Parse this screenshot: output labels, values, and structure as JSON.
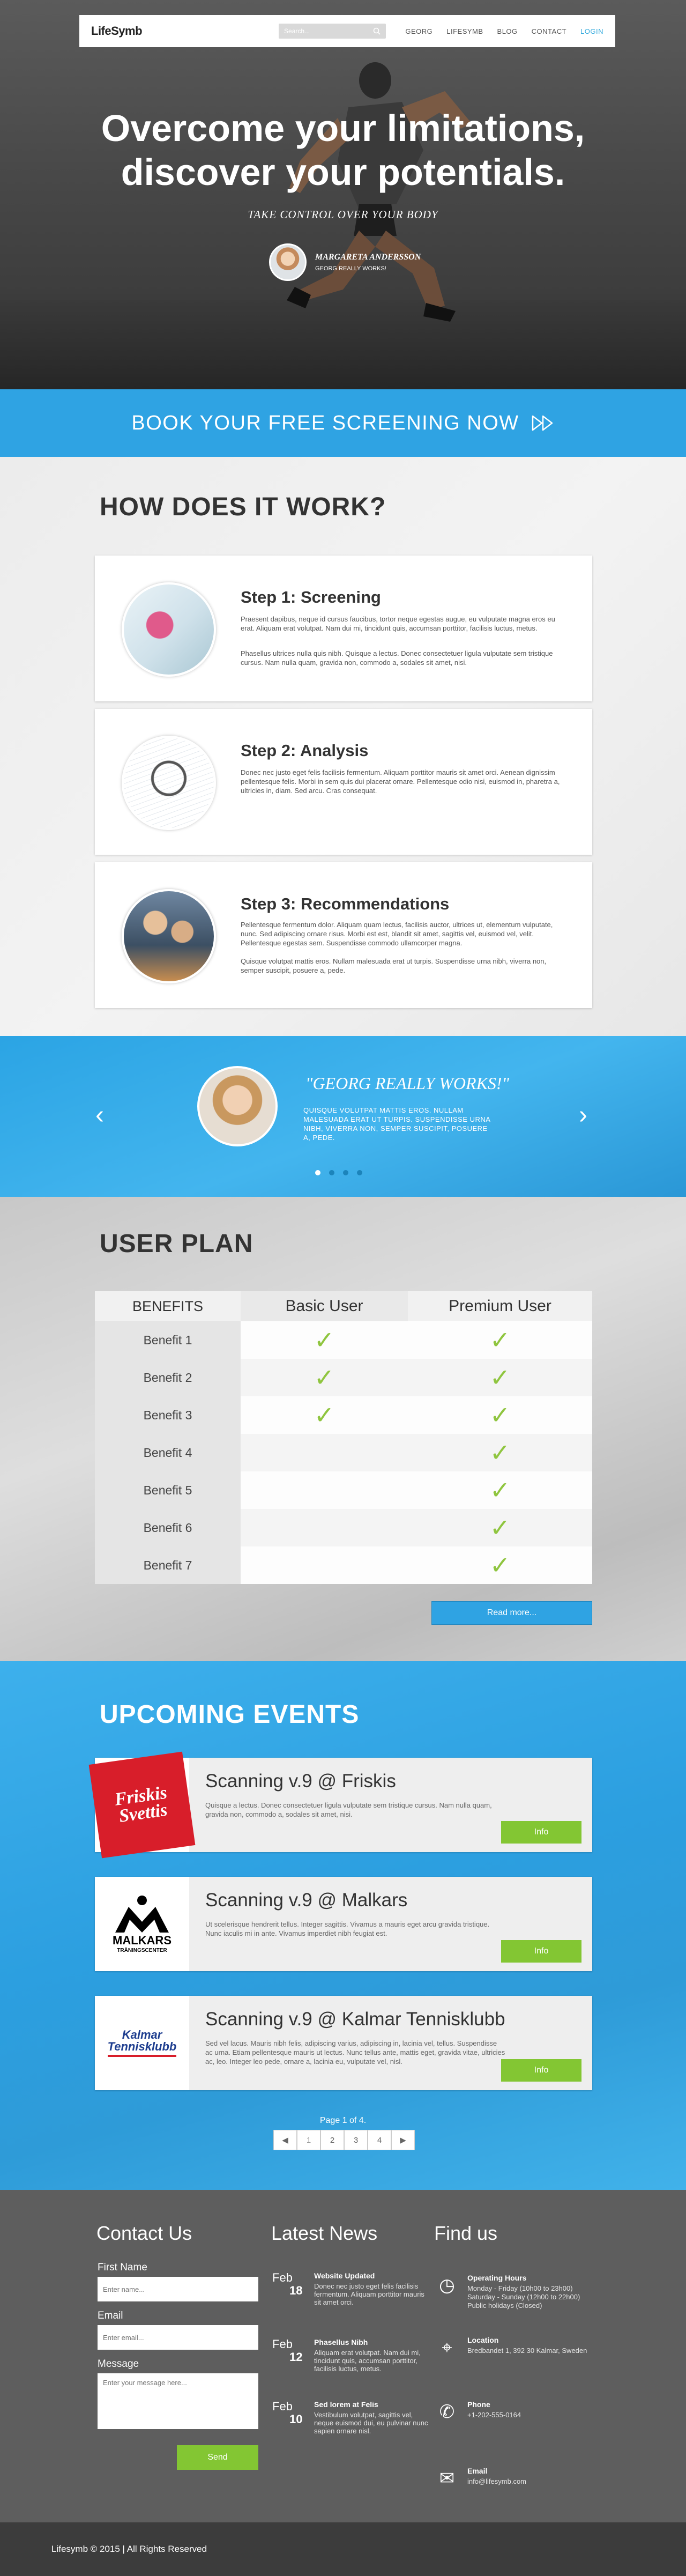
{
  "nav": {
    "logo": "LifeSymb",
    "search_placeholder": "Search...",
    "links": [
      "GEORG",
      "LIFESYMB",
      "BLOG",
      "CONTACT",
      "LOGIN"
    ]
  },
  "hero": {
    "title_line1": "Overcome your limitations,",
    "title_line2": "discover your potentials.",
    "tagline": "TAKE CONTROL OVER YOUR BODY",
    "quote_name": "MARGARETA ANDERSSON",
    "quote_text": "GEORG REALLY WORKS!"
  },
  "book": {
    "label": "BOOK YOUR FREE SCREENING NOW"
  },
  "how": {
    "title": "HOW DOES IT WORK?",
    "steps": [
      {
        "title": "Step 1: Screening",
        "p1": "Praesent dapibus, neque id cursus faucibus, tortor neque egestas augue, eu vulputate magna eros eu erat. Aliquam erat volutpat. Nam dui mi, tincidunt quis, accumsan porttitor, facilisis luctus, metus.",
        "p2": "Phasellus ultrices nulla quis nibh. Quisque a lectus. Donec consectetuer ligula vulputate sem tristique cursus. Nam nulla quam, gravida non, commodo a, sodales sit amet, nisi."
      },
      {
        "title": "Step 2: Analysis",
        "p1": "Donec nec justo eget felis facilisis fermentum. Aliquam porttitor mauris sit amet orci. Aenean dignissim pellentesque felis. Morbi in sem quis dui placerat ornare. Pellentesque odio nisi, euismod in, pharetra a, ultricies in, diam. Sed arcu. Cras consequat.",
        "p2": ""
      },
      {
        "title": "Step 3: Recommendations",
        "p1": "Pellentesque fermentum dolor. Aliquam quam lectus, facilisis auctor, ultrices ut, elementum vulputate, nunc. Sed adipiscing ornare risus. Morbi est est, blandit sit amet, sagittis vel, euismod vel, velit. Pellentesque egestas sem. Suspendisse commodo ullamcorper magna.",
        "p2": "Quisque volutpat mattis eros. Nullam malesuada erat ut turpis. Suspendisse urna nibh, viverra non, semper suscipit, posuere a, pede."
      }
    ]
  },
  "testimonial": {
    "quote": "\"GEORG REALLY WORKS!\"",
    "text": "QUISQUE VOLUTPAT MATTIS EROS. NULLAM MALESUADA ERAT UT TURPIS. SUSPENDISSE URNA NIBH, VIVERRA NON, SEMPER SUSCIPIT, POSUERE A, PEDE.",
    "prev": "‹",
    "next": "›"
  },
  "plan": {
    "title": "USER PLAN",
    "headers": [
      "BENEFITS",
      "Basic User",
      "Premium User"
    ],
    "rows": [
      {
        "name": "Benefit 1",
        "basic": true,
        "premium": true
      },
      {
        "name": "Benefit 2",
        "basic": true,
        "premium": true
      },
      {
        "name": "Benefit 3",
        "basic": true,
        "premium": true
      },
      {
        "name": "Benefit 4",
        "basic": false,
        "premium": true
      },
      {
        "name": "Benefit 5",
        "basic": false,
        "premium": true
      },
      {
        "name": "Benefit 6",
        "basic": false,
        "premium": true
      },
      {
        "name": "Benefit 7",
        "basic": false,
        "premium": true
      }
    ],
    "read_more": "Read more..."
  },
  "events": {
    "title": "UPCOMING EVENTS",
    "items": [
      {
        "title": "Scanning v.9 @ Friskis",
        "text": "Quisque a lectus. Donec consectetuer ligula vulputate sem tristique cursus. Nam nulla quam, gravida non, commodo a, sodales sit amet, nisi.",
        "button": "Info"
      },
      {
        "title": "Scanning v.9 @ Malkars",
        "text": "Ut scelerisque hendrerit tellus. Integer sagittis. Vivamus a mauris eget arcu gravida tristique. Nunc iaculis mi in ante. Vivamus imperdiet nibh feugiat est.",
        "button": "Info"
      },
      {
        "title": "Scanning v.9 @ Kalmar Tennisklubb",
        "text": "Sed vel lacus. Mauris nibh felis, adipiscing varius, adipiscing in, lacinia vel, tellus. Suspendisse ac urna. Etiam pellentesque mauris ut lectus. Nunc tellus ante, mattis eget, gravida vitae, ultricies ac, leo. Integer leo pede, ornare a, lacinia eu, vulputate vel, nisl.",
        "button": "Info"
      }
    ],
    "logos": {
      "friskis_line1": "Friskis",
      "friskis_line2": "Svettis",
      "malkars_name": "MALKARS",
      "malkars_sub": "TRÄNINGSCENTER",
      "kalmar_line1": "Kalmar",
      "kalmar_line2": "Tennisklubb"
    },
    "page_text": "Page 1 of 4.",
    "pages": [
      "◀",
      "1",
      "2",
      "3",
      "4",
      "▶"
    ]
  },
  "footer": {
    "contact_title": "Contact Us",
    "first_name_label": "First Name",
    "first_name_placeholder": "Enter name...",
    "email_label": "Email",
    "email_placeholder": "Enter email...",
    "message_label": "Message",
    "message_placeholder": "Enter your message here...",
    "send": "Send",
    "news_title": "Latest News",
    "news": [
      {
        "month": "Feb",
        "day": "18",
        "title": "Website Updated",
        "text": "Donec nec justo eget felis facilisis fermentum. Aliquam porttitor mauris sit amet orci."
      },
      {
        "month": "Feb",
        "day": "12",
        "title": "Phasellus Nibh",
        "text": "Aliquam erat volutpat. Nam dui mi, tincidunt quis, accumsan porttitor, facilisis luctus, metus."
      },
      {
        "month": "Feb",
        "day": "10",
        "title": "Sed lorem at Felis",
        "text": "Vestibulum volutpat, sagittis vel, neque euismod dui, eu pulvinar nunc sapien ornare nisl."
      }
    ],
    "find_title": "Find us",
    "find": [
      {
        "icon": "clock-icon",
        "glyph": "◷",
        "title": "Operating Hours",
        "text": "Monday - Friday (10h00 to 23h00)\nSaturday - Sunday (12h00 to 22h00)\nPublic holidays (Closed)"
      },
      {
        "icon": "location-icon",
        "glyph": "⌖",
        "title": "Location",
        "text": "Bredbandet 1, 392 30 Kalmar, Sweden"
      },
      {
        "icon": "phone-icon",
        "glyph": "✆",
        "title": "Phone",
        "text": "+1-202-555-0164"
      },
      {
        "icon": "mail-icon",
        "glyph": "✉",
        "title": "Email",
        "text": "info@lifesymb.com"
      }
    ],
    "copyright": "Lifesymb © 2015 | All Rights Reserved"
  },
  "colors": {
    "accent": "#2fa3e3",
    "green": "#83c633",
    "footer": "#5e5e5e",
    "bottom_bar": "#3c3c3c"
  }
}
